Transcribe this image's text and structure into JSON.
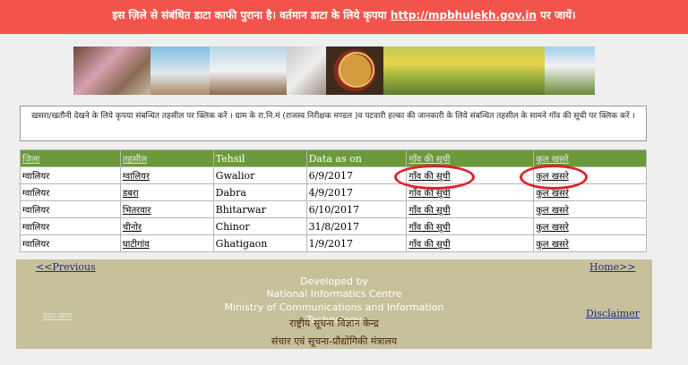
{
  "banner": {
    "text": "इस ज़िले से संबंधित डाटा काफी पुराना है। वर्तमान डाटा के लिये कृपया",
    "link": "http://mpbhulekh.gov.in",
    "suffix": "पर जायें।"
  },
  "instructions": "खसरा/खतौनी देखने के लिये कृपया संबन्धित तहसील पर क्लिक करें । ग्राम के रा.नि.मं (राजस्व निरीक्षक मण्डल )व पटवारी हल्का की जानकारी के लिये संबन्धित तहसील के सामने गाँव की सूची पर क्लिक करें ।",
  "table": {
    "headers": {
      "district": "जिला",
      "tehsil_hi": "तहसील",
      "tehsil_en": "Tehsil",
      "date": "Data as on",
      "village_list": "गाँव की सूची",
      "total_khasra": "कुल खसरे"
    },
    "rows": [
      {
        "district": "ग्वालियर",
        "tehsil_hi": "ग्वालियर",
        "tehsil_en": "Gwalior",
        "date": "6/9/2017",
        "village_list": "गाँव की सूची",
        "total_khasra": "कुल खसरे"
      },
      {
        "district": "ग्वालियर",
        "tehsil_hi": "डबरा",
        "tehsil_en": "Dabra",
        "date": "4/9/2017",
        "village_list": "गाँव की सूची",
        "total_khasra": "कुल खसरे"
      },
      {
        "district": "ग्वालियर",
        "tehsil_hi": "भितरवार",
        "tehsil_en": "Bhitarwar",
        "date": "6/10/2017",
        "village_list": "गाँव की सूची",
        "total_khasra": "कुल खसरे"
      },
      {
        "district": "ग्वालियर",
        "tehsil_hi": "चीनोर",
        "tehsil_en": "Chinor",
        "date": "31/8/2017",
        "village_list": "गाँव की सूची",
        "total_khasra": "कुल खसरे"
      },
      {
        "district": "ग्वालियर",
        "tehsil_hi": "घाटीगांव",
        "tehsil_en": "Ghatigaon",
        "date": "1/9/2017",
        "village_list": "गाँव की सूची",
        "total_khasra": "कुल खसरे"
      }
    ]
  },
  "footer": {
    "previous": "<<Previous",
    "home": "Home>>",
    "left_link": "डाटा त्याग",
    "disclaimer": "Disclaimer",
    "developed_by": "Developed by",
    "nic": "National Informatics Centre",
    "ministry": "Ministry of Communications and Information Technology",
    "nic_hi": "राष्ट्रीय सूचना विज्ञान केन्द्र",
    "ministry_hi": "संचार एवं सूचना-प्रौद्योगिकी मंत्रालय"
  },
  "colors": {
    "banner": "#f2534a",
    "table_header": "#6b9a3a",
    "footer": "#c6c19b",
    "highlight_circle": "#e0202a"
  }
}
